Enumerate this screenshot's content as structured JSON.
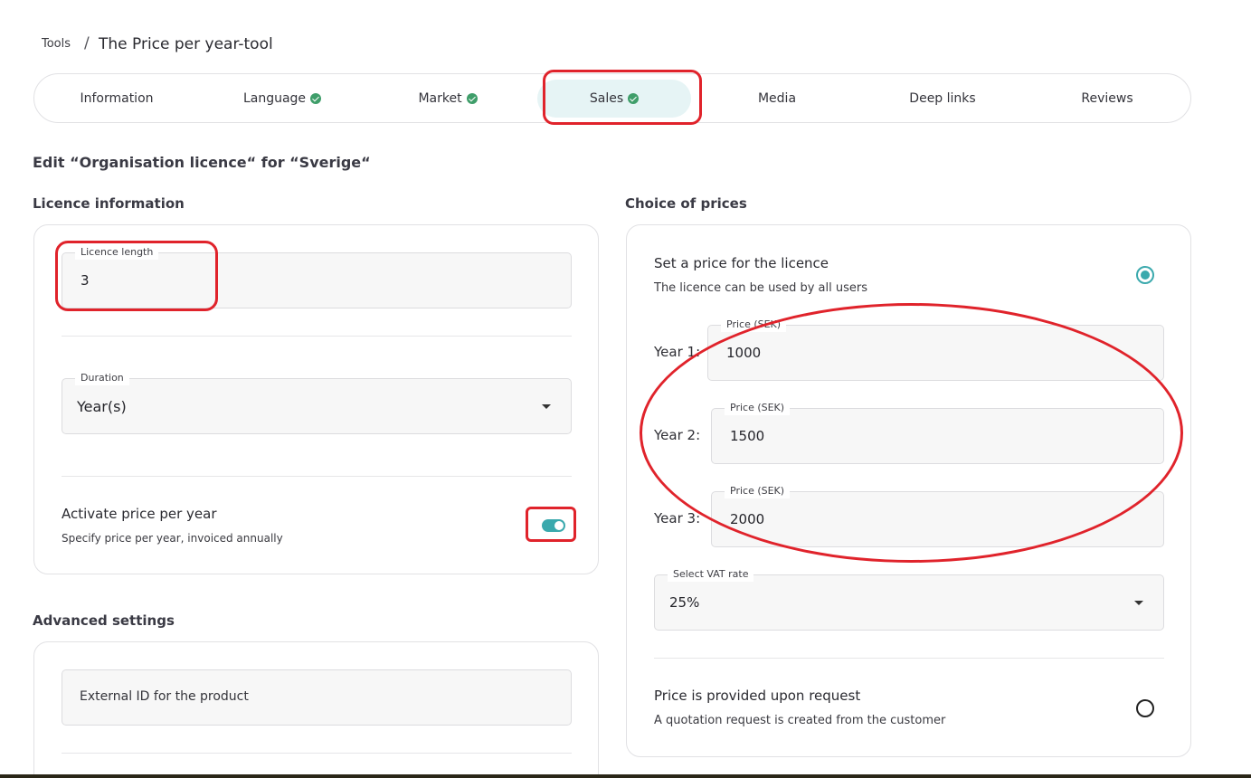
{
  "breadcrumb": {
    "root": "Tools",
    "separator": "/",
    "current": "The Price per year-tool"
  },
  "tabs": [
    {
      "label": "Information",
      "done": false
    },
    {
      "label": "Language",
      "done": true
    },
    {
      "label": "Market",
      "done": true
    },
    {
      "label": "Sales",
      "done": true,
      "active": true
    },
    {
      "label": "Media",
      "done": false
    },
    {
      "label": "Deep links",
      "done": false
    },
    {
      "label": "Reviews",
      "done": false
    }
  ],
  "page": {
    "edit_title": "Edit “Organisation licence“ for “Sverige“"
  },
  "licence_info": {
    "heading": "Licence information",
    "length_label": "Licence length",
    "length_value": "3",
    "duration_label": "Duration",
    "duration_value": "Year(s)",
    "price_per_year_title": "Activate price per year",
    "price_per_year_sub": "Specify price per year, invoiced annually",
    "price_per_year_on": true
  },
  "advanced": {
    "heading": "Advanced settings",
    "external_id_placeholder": "External ID for the product"
  },
  "prices": {
    "heading": "Choice of prices",
    "set_price_title": "Set a price for the licence",
    "set_price_sub": "The licence can be used by all users",
    "set_price_selected": true,
    "years": [
      {
        "label": "Year 1:",
        "field_label": "Price (SEK)",
        "value": "1000"
      },
      {
        "label": "Year 2:",
        "field_label": "Price (SEK)",
        "value": "1500"
      },
      {
        "label": "Year 3:",
        "field_label": "Price (SEK)",
        "value": "2000"
      }
    ],
    "vat_label": "Select VAT rate",
    "vat_value": "25%",
    "request_title": "Price is provided upon request",
    "request_sub": "A quotation request is created from the customer",
    "request_selected": false
  },
  "colors": {
    "accent": "#3aa9ad",
    "check": "#3f9e6a",
    "annotation": "#e0232b",
    "active_tab_bg": "#e6f4f5"
  },
  "icons": {
    "check": "check-circle-icon",
    "dropdown": "caret-down-icon"
  }
}
